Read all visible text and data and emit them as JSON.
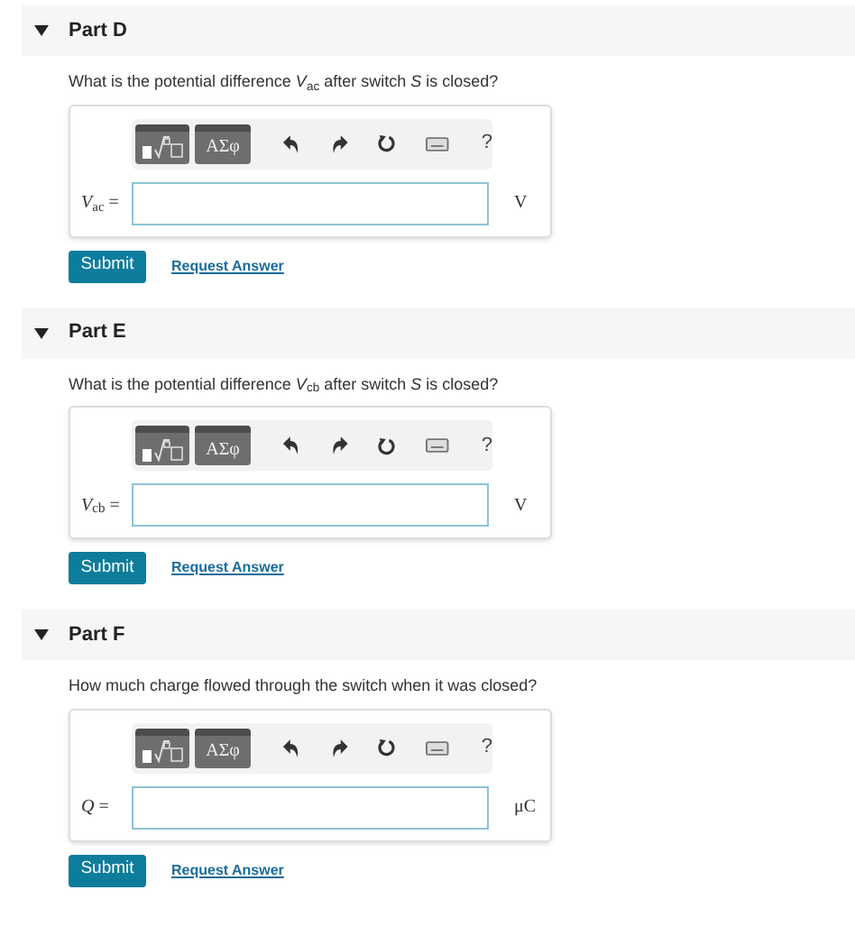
{
  "parts": [
    {
      "title": "Part D",
      "expanded": true,
      "question": "What is the potential difference *V*$_{ac}$ after switch *S* is closed?",
      "toolbar": {
        "symbols": "ΑΣφ",
        "help": "?"
      },
      "answer": {
        "label": "*V*$_{ac}$ =",
        "unit": "V"
      },
      "submit": "Submit",
      "request": "Request Answer"
    },
    {
      "title": "Part E",
      "expanded": true,
      "question": "What is the potential difference *V*$_{cb}$ after switch *S* is closed?",
      "toolbar": {
        "symbols": "ΑΣφ",
        "help": "?"
      },
      "answer": {
        "label": "*V*$_{cb}$ =",
        "unit": "V"
      },
      "submit": "Submit",
      "request": "Request Answer"
    },
    {
      "title": "Part F",
      "expanded": true,
      "question": "How much charge flowed through the switch when it was closed?",
      "toolbar": {
        "symbols": "ΑΣφ",
        "help": "?"
      },
      "answer": {
        "label": "*Q* =",
        "unit": "μC"
      },
      "submit": "Submit",
      "request": "Request Answer"
    }
  ]
}
